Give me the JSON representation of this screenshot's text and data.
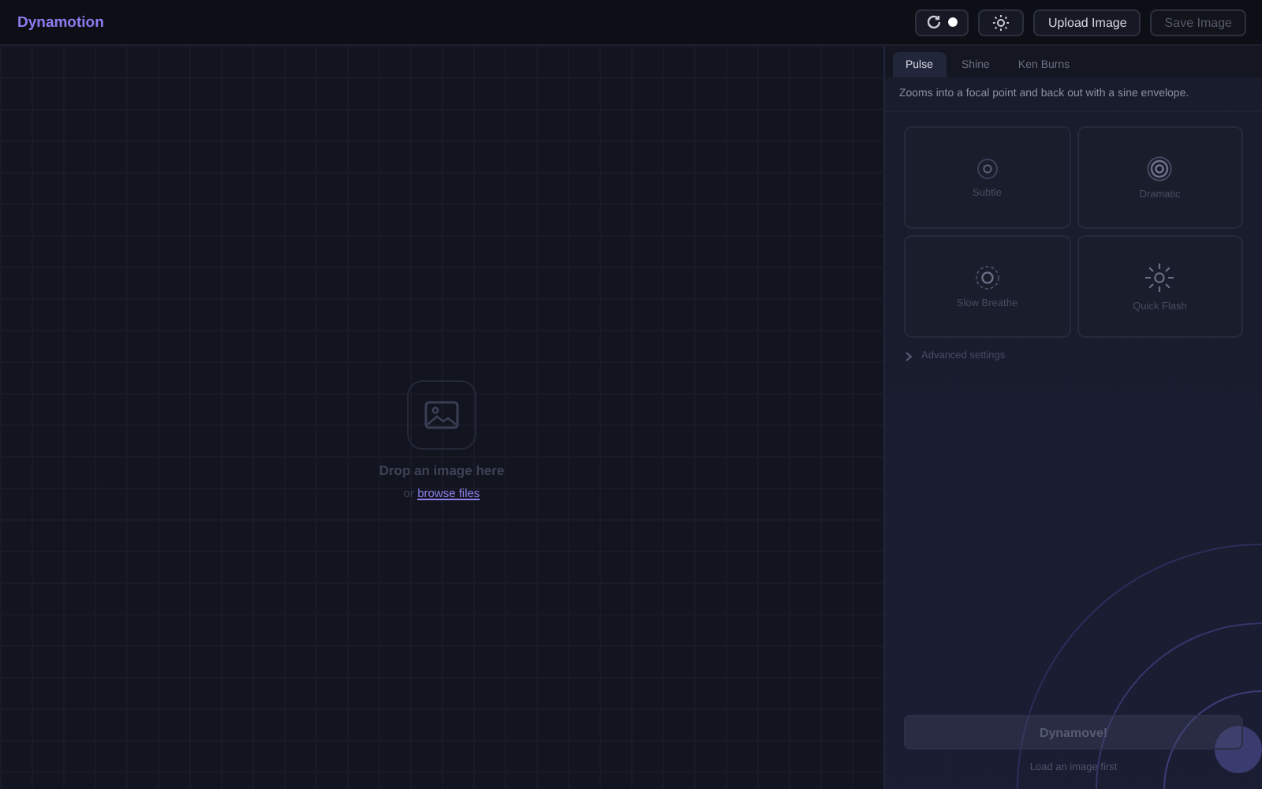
{
  "app": {
    "title": "Dynamotion"
  },
  "header": {
    "loop_toggle": {
      "on": true
    },
    "buttons": [
      {
        "label": "Upload Image",
        "disabled": false
      },
      {
        "label": "Save Image",
        "disabled": true
      }
    ]
  },
  "dropzone": {
    "title": "Drop an image here",
    "prefix": "or",
    "link": "browse files"
  },
  "tabs": [
    {
      "label": "Pulse",
      "selected": true
    },
    {
      "label": "Shine",
      "selected": false
    },
    {
      "label": "Ken Burns",
      "selected": false
    }
  ],
  "description": "Zooms into a focal point and back out with a sine envelope.",
  "presets": [
    {
      "label": "Subtle",
      "kind": "subtle",
      "selected": false
    },
    {
      "label": "Dramatic",
      "kind": "dramatic",
      "selected": false
    },
    {
      "label": "Slow Breathe",
      "kind": "breathe",
      "selected": false
    },
    {
      "label": "Quick Flash",
      "kind": "flash",
      "selected": false
    }
  ],
  "advanced": {
    "label": "Advanced settings",
    "expanded": false
  },
  "action": {
    "label": "Dynamove!",
    "disabled": true,
    "hint": "Load an image first"
  }
}
